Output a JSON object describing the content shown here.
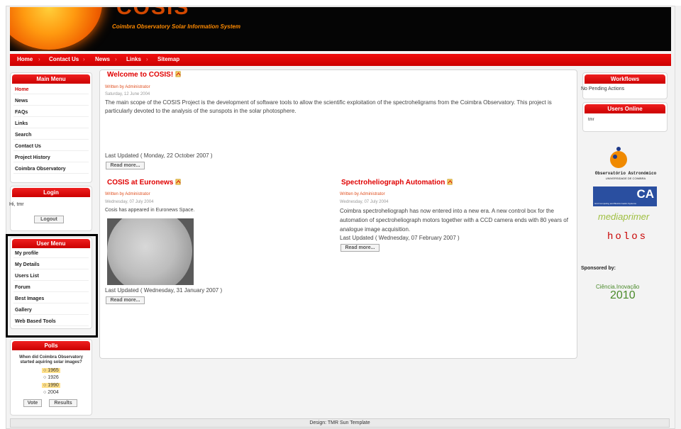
{
  "header": {
    "logo_letters": "COSIS",
    "subtitle": "Coimbra Observatory Solar Information System"
  },
  "nav": {
    "items": [
      "Home",
      "Contact Us",
      "News",
      "Links",
      "Sitemap"
    ]
  },
  "main_menu": {
    "title": "Main Menu",
    "items": [
      "Home",
      "News",
      "FAQs",
      "Links",
      "Search",
      "Contact Us",
      "Project History",
      "Coimbra Observatory"
    ]
  },
  "login": {
    "title": "Login",
    "greeting": "Hi, tmr",
    "logout_label": "Logout"
  },
  "user_menu": {
    "title": "User Menu",
    "items": [
      "My profile",
      "My Details",
      "Users List",
      "Forum",
      "Best Images",
      "Gallery",
      "Web Based Tools"
    ]
  },
  "polls": {
    "title": "Polls",
    "question": "When did Coimbra Observatory started aquiring solar images?",
    "options": [
      "1965",
      "1926",
      "1990",
      "2004"
    ],
    "vote_label": "Vote",
    "results_label": "Results"
  },
  "articles": [
    {
      "title": "Welcome to COSIS!",
      "author": "Written by Administrator",
      "date": "Saturday, 12 June 2004",
      "body": "The main scope of the COSIS Project is the development of software tools to allow the scientific exploitation of the spectroheligrams from the Coimbra Observatory. This project is particularly devoted to the analysis of the sunspots in the solar photosphere.",
      "updated": "Last Updated ( Monday, 22 October 2007 )",
      "read_more": "Read more..."
    },
    {
      "title": "COSIS at Euronews",
      "author": "Written by Administrator",
      "date": "Wednesday, 07 July 2004",
      "body": "Cosis has appeared in Euronews Space.",
      "updated": "Last Updated ( Wednesday, 31 January 2007 )",
      "read_more": "Read more..."
    },
    {
      "title": "Spectroheliograph Automation",
      "author": "Written by Administrator",
      "date": "Wednesday, 07 July 2004",
      "body": "Coimbra spectroheliograph has now entered into a new era. A new control box for the automation of spectroheliograph motors together with a CCD camera ends with 80 years of analogue image acquisition.",
      "updated": "Last Updated ( Wednesday, 07 February 2007 )",
      "read_more": "Read more..."
    }
  ],
  "workflows": {
    "title": "Workflows",
    "text": "No Pending Actions"
  },
  "users_online": {
    "title": "Users Online",
    "user": "tmr"
  },
  "sponsors": {
    "observatorio_line1": "Observatório Astronómico",
    "observatorio_line2": "UNIVERSIDADE DE COIMBRA",
    "ca_logo": "CA",
    "ca_sub": "Grid Computing and Bioinformatics Systems",
    "mediaprimer": "mediaprimer",
    "holos": "holos",
    "sponsored_by": "Sponsored by:",
    "ciencia_line1": "Ciência.Inovação",
    "ciencia_line2": "2010"
  },
  "footer": {
    "text": "Design: TMR Sun Template"
  },
  "colors": {
    "accent_red": "#cc0000",
    "header_bg": "#050505",
    "highlight_border": "#000000"
  }
}
